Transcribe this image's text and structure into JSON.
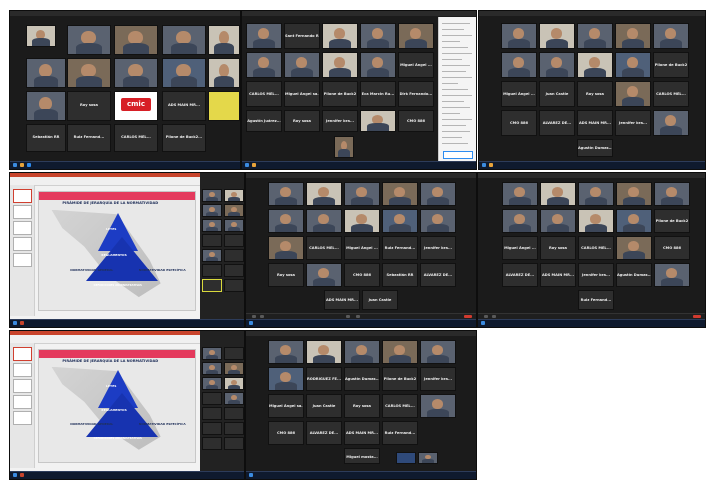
{
  "panel1": {
    "names": [
      "Roy sosa",
      "Sebastián RR",
      "Ruiz Fernand...",
      "CARLOS MEL...",
      "Pilone de Buck2..."
    ],
    "logo_text": "cmic",
    "mid_label": "ADS MAIN MR..."
  },
  "panel2": {
    "names": [
      "Sant Fernando R...",
      "Miguel Ángel ...",
      "CARLOS MEL...",
      "Miguel Ángel sa...",
      "Pilone de Buck2",
      "Eca Marcin Ru...",
      "Dirk Fernando...",
      "Roy sosa",
      "Agustín Juárez...",
      "Jennifer bra...",
      "Juan ara",
      "CMO 886",
      "Miguel mosta..."
    ]
  },
  "panel3": {
    "names": [
      "Pilone de Buck2",
      "Miguel Ángel ...",
      "Juan Castle",
      "Roy sosa",
      "CARLOS MEL...",
      "CMO 886",
      "ALVAREZ DE...",
      "ADS MAIN MR...",
      "Jennifer bra...",
      "Agustín Dumas..."
    ]
  },
  "slide": {
    "title": "PIRÁMIDE DE JERARQUÍA DE LA NORMATIVIDAD",
    "top": "LEYES",
    "mid": "REGLAMENTOS",
    "base": "DEFINICIONES ADMINISTRATIVAS",
    "left": "NORMATIVIDAD GENERAL",
    "right": "NORMATIVIDAD ESPECÍFICA"
  },
  "panel5": {
    "names": [
      "CARLOS MEL...",
      "Miguel Ángel ...",
      "Ruiz Fernand...",
      "Jennifer bra...",
      "Roy sosa",
      "CMO 886",
      "Sebastián RR",
      "ALVAREZ DE...",
      "ADS MAIN MR...",
      "Juan Castle"
    ]
  },
  "panel6": {
    "names": [
      "Pilone de Buck2",
      "Miguel Ángel ...",
      "Roy sosa",
      "CARLOS MEL...",
      "CMO 886",
      "ALVAREZ DE...",
      "ADS MAIN MR...",
      "Jennifer bra...",
      "Agustín Dumas...",
      "Ruiz Fernand..."
    ]
  },
  "panel8": {
    "names": [
      "RODRIGUEZ FE...",
      "Agustín Dumas...",
      "Pilone de Buck2",
      "Jennifer bra...",
      "Miguel Ángel sa...",
      "Juan Castle",
      "Roy sosa",
      "CARLOS MEL...",
      "CMO 886",
      "ALVAREZ DE...",
      "ADS MAIN MR...",
      "Ruiz Fernand...",
      "Miguel mosta..."
    ]
  }
}
